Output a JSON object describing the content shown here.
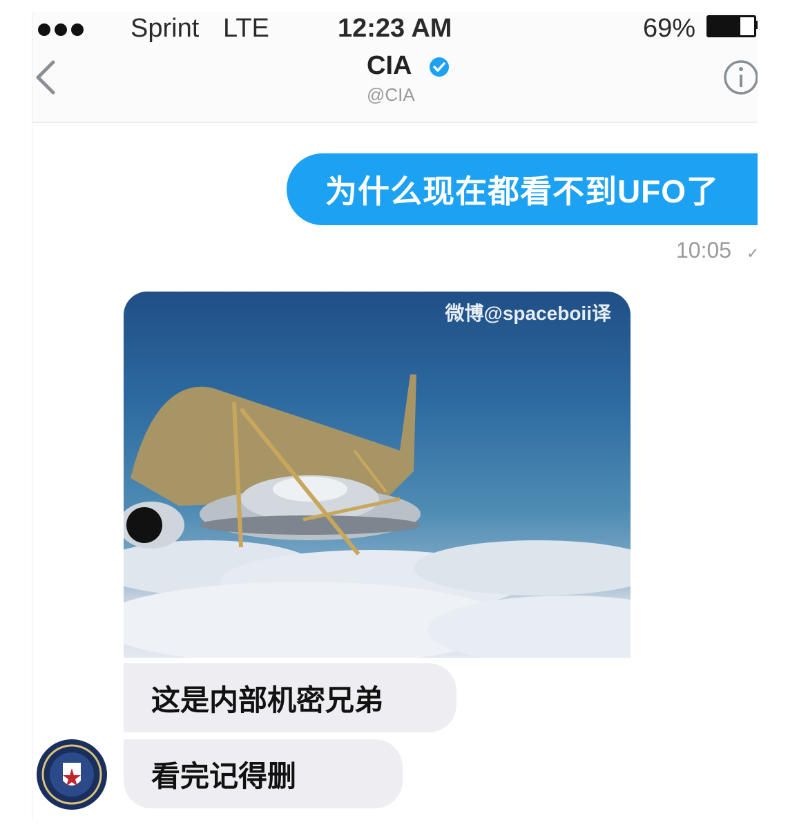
{
  "status_bar": {
    "carrier": "Sprint",
    "network": "LTE",
    "time": "12:23 AM",
    "battery_pct": "69%",
    "battery_level": 0.69
  },
  "nav": {
    "back_icon": "chevron-left-icon",
    "contact_name": "CIA",
    "verified_icon": "verified-badge-icon",
    "contact_handle": "@CIA",
    "info_icon": "info-icon"
  },
  "messages": {
    "outgoing_text": "为什么现在都看不到UFO了",
    "outgoing_time": "10:05",
    "read_icon": "check-icon",
    "image_watermark": "微博@spaceboii译",
    "incoming_1": "这是内部机密兄弟",
    "incoming_2": "看完记得删",
    "avatar_icon": "cia-seal-avatar"
  },
  "colors": {
    "outgoing_bubble": "#1da1f2",
    "incoming_bubble": "#eeedf2",
    "verified_blue": "#1da1f2"
  }
}
